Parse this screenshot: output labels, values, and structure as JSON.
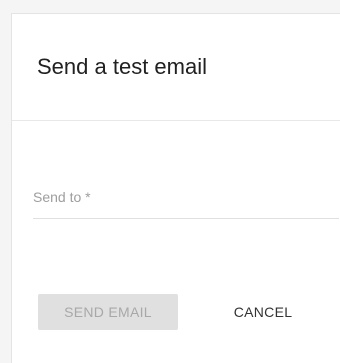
{
  "dialog": {
    "title": "Send a test email",
    "field": {
      "label": "Send to *",
      "value": ""
    },
    "actions": {
      "send_label": "SEND EMAIL",
      "cancel_label": "CANCEL"
    }
  }
}
